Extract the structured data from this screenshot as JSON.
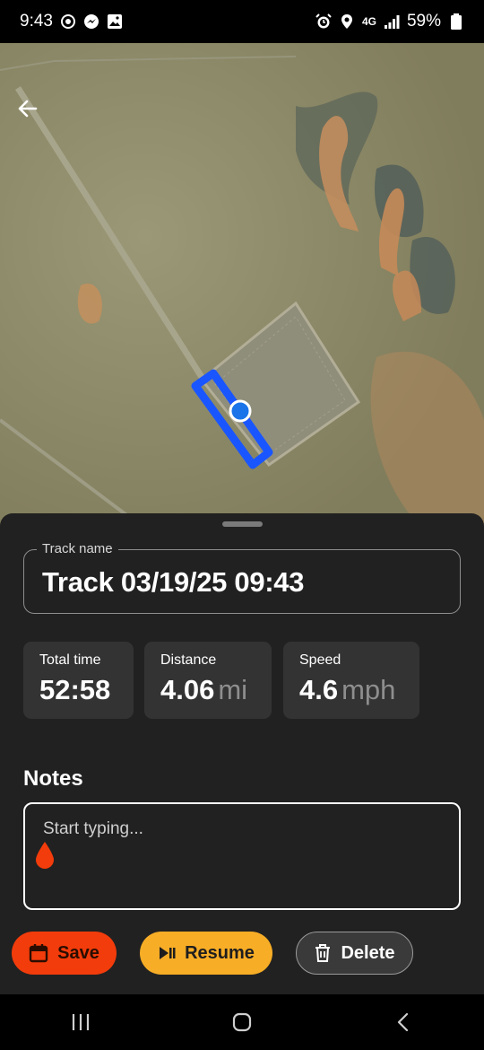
{
  "status_bar": {
    "time": "9:43",
    "network": "4G",
    "battery": "59%",
    "left_icons": [
      "chat-bubble-icon",
      "messenger-icon",
      "gallery-icon"
    ],
    "right_icons": [
      "alarm-icon",
      "location-icon",
      "signal-icon",
      "battery-icon"
    ]
  },
  "map": {
    "back_icon": "arrow-left-icon",
    "track_color": "#1a56ff",
    "position_marker_color": "#1a73e8"
  },
  "track": {
    "name_label": "Track name",
    "name_value": "Track 03/19/25 09:43"
  },
  "stats": [
    {
      "label": "Total time",
      "value": "52:58",
      "unit": ""
    },
    {
      "label": "Distance",
      "value": "4.06",
      "unit": "mi"
    },
    {
      "label": "Speed",
      "value": "4.6",
      "unit": "mph"
    }
  ],
  "notes": {
    "heading": "Notes",
    "placeholder": "Start typing..."
  },
  "actions": {
    "save_label": "Save",
    "resume_label": "Resume",
    "delete_label": "Delete"
  },
  "colors": {
    "sheet_bg": "#212121",
    "save": "#f23c0b",
    "resume": "#f7ad26",
    "delete_bg": "#3a3a3a"
  },
  "nav_bar": {
    "icons": [
      "recent-apps-icon",
      "home-icon",
      "back-icon"
    ]
  }
}
